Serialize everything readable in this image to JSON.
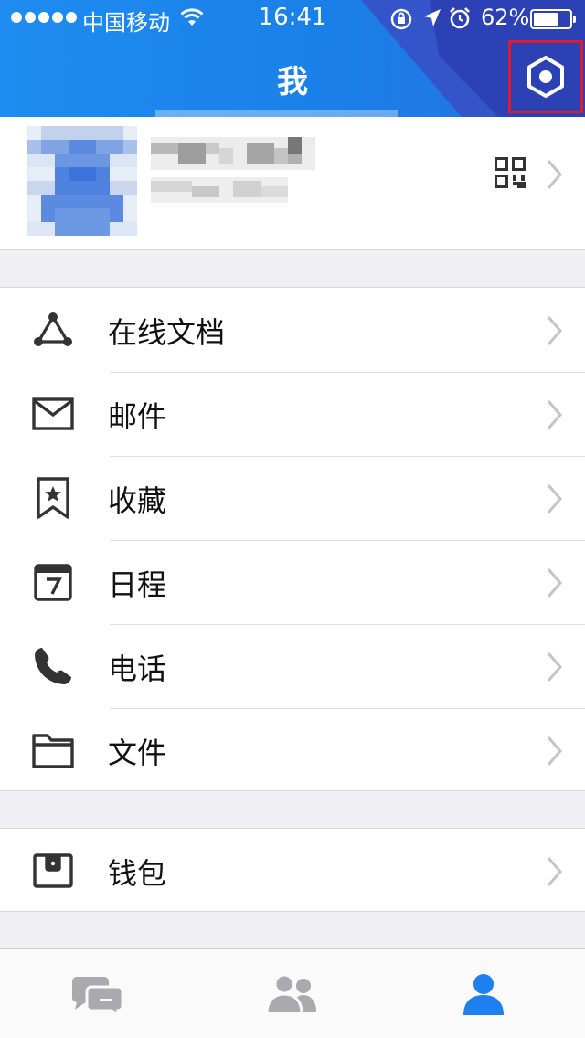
{
  "status_bar": {
    "carrier": "中国移动",
    "time": "16:41",
    "battery_percent": "62%",
    "battery_level": 0.62,
    "icons": [
      "signal-dots-icon",
      "wifi-icon",
      "orientation-lock-icon",
      "location-arrow-icon",
      "alarm-clock-icon",
      "battery-icon"
    ]
  },
  "nav": {
    "title": "我",
    "right_button_icon": "settings-hexagon-icon",
    "highlight_color": "#e0192b"
  },
  "profile": {
    "avatar_icon": "avatar-pixelated",
    "qr_icon": "qr-code-icon"
  },
  "menu_groups": [
    {
      "items": [
        {
          "label": "在线文档",
          "icon": "online-docs-icon"
        },
        {
          "label": "邮件",
          "icon": "mail-icon"
        },
        {
          "label": "收藏",
          "icon": "bookmark-star-icon"
        },
        {
          "label": "日程",
          "icon": "calendar-icon"
        },
        {
          "label": "电话",
          "icon": "phone-icon"
        },
        {
          "label": "文件",
          "icon": "folder-icon"
        }
      ]
    },
    {
      "items": [
        {
          "label": "钱包",
          "icon": "wallet-icon"
        }
      ]
    }
  ],
  "tab_bar": {
    "tabs": [
      {
        "name": "messages",
        "icon": "chat-bubbles-icon",
        "active": false
      },
      {
        "name": "contacts",
        "icon": "contacts-icon",
        "active": false
      },
      {
        "name": "me",
        "icon": "person-icon",
        "active": true
      }
    ],
    "active_color": "#1e7ff0",
    "inactive_color": "#a9a9ae"
  },
  "colors": {
    "header_blue": "#1e8cf0",
    "header_accent": "#2b3fb0",
    "background": "#efeff4"
  }
}
